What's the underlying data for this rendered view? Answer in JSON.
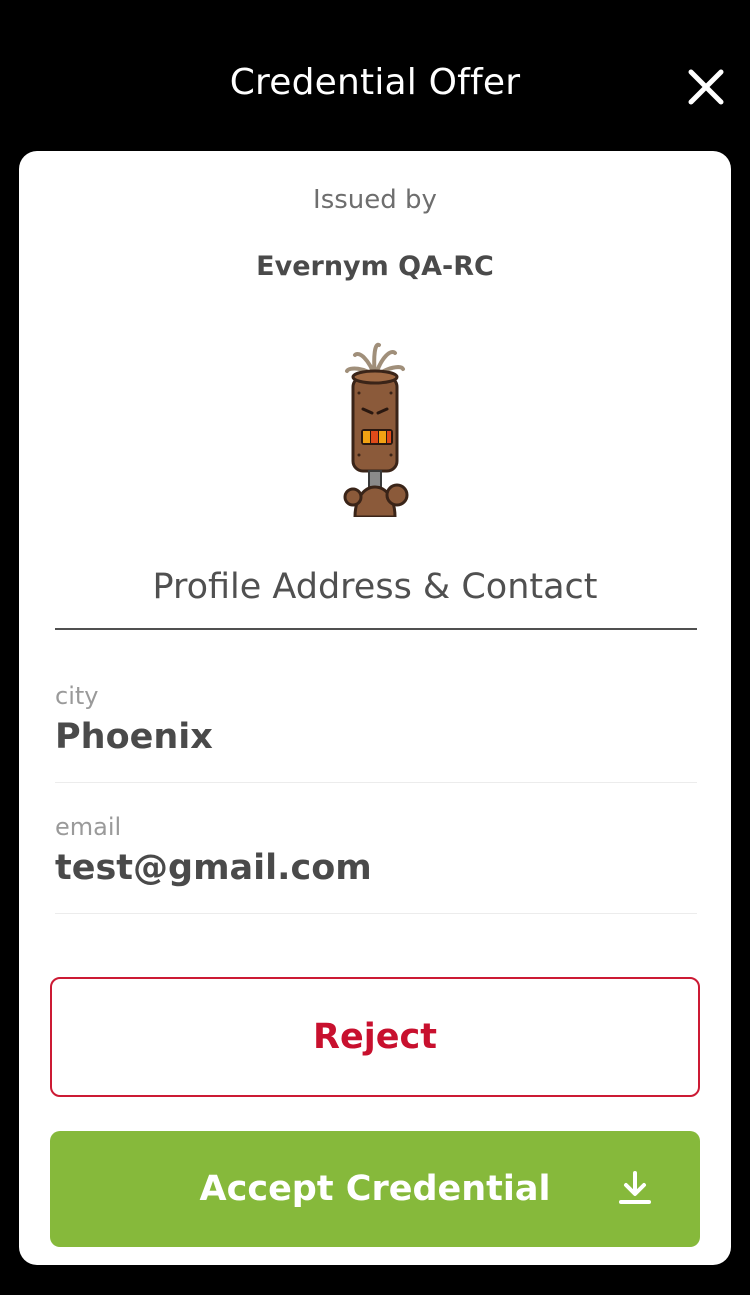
{
  "header": {
    "title": "Credential Offer",
    "close_icon": "close-icon"
  },
  "issuer": {
    "issued_by_label": "Issued by",
    "name": "Evernym QA-RC",
    "avatar_icon": "robot-avatar-icon"
  },
  "credential": {
    "title": "Profile Address & Contact",
    "attributes": [
      {
        "label": "city",
        "value": "Phoenix"
      },
      {
        "label": "email",
        "value": "test@gmail.com"
      }
    ]
  },
  "actions": {
    "reject_label": "Reject",
    "accept_label": "Accept Credential",
    "accept_icon": "download-icon"
  },
  "colors": {
    "reject": "#c8102e",
    "accept": "#86b93b",
    "background": "#000000",
    "card": "#ffffff"
  }
}
